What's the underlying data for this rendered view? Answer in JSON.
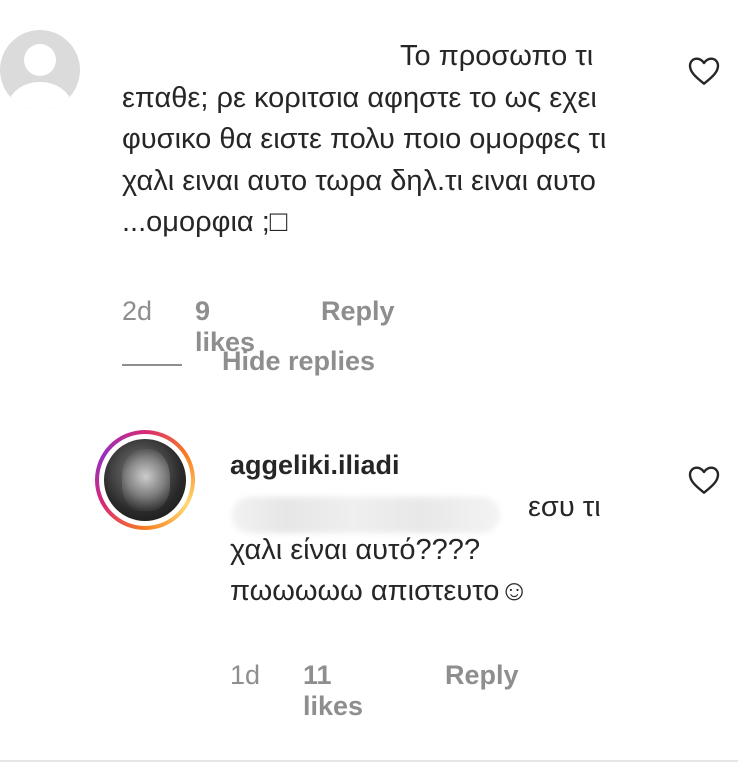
{
  "comment": {
    "text": "Το προσωπο τι επαθε; ρε κοριτσια αφηστε το ως εχει φυσικο θα ειστε πολυ ποιο ομορφες τι χαλι ειναι αυτο τωρα δηλ.τι ειναι αυτο ...ομορφια ;□",
    "age": "2d",
    "likes": "9 likes",
    "reply_label": "Reply",
    "hide_replies_label": "Hide replies",
    "like_icon": "heart-outline-icon"
  },
  "reply": {
    "username": "aggeliki.iliadi",
    "line1": "εσυ τι",
    "line2": "χαλι είναι αυτό????",
    "line3": "πωωωωω απιστευτο☺",
    "age": "1d",
    "likes": "11 likes",
    "reply_label": "Reply",
    "like_icon": "heart-outline-icon"
  },
  "colors": {
    "text": "#262626",
    "meta": "#8e8e8e",
    "avatar_ring": "#d62976"
  }
}
